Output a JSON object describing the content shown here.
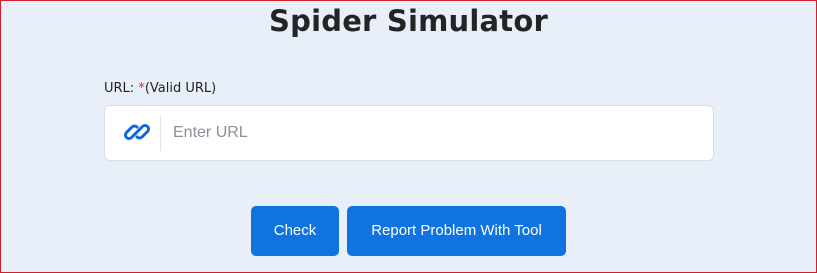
{
  "page": {
    "title": "Spider Simulator"
  },
  "url_field": {
    "label": "URL:",
    "required_mark": "*",
    "hint": "(Valid URL)",
    "placeholder": "Enter URL",
    "value": "",
    "icon": "link-icon"
  },
  "actions": {
    "check_label": "Check",
    "report_label": "Report Problem With Tool"
  },
  "colors": {
    "background": "#e9eff9",
    "primary": "#0f73e0",
    "required": "#e0212c",
    "frame_border": "#d21f2b"
  }
}
